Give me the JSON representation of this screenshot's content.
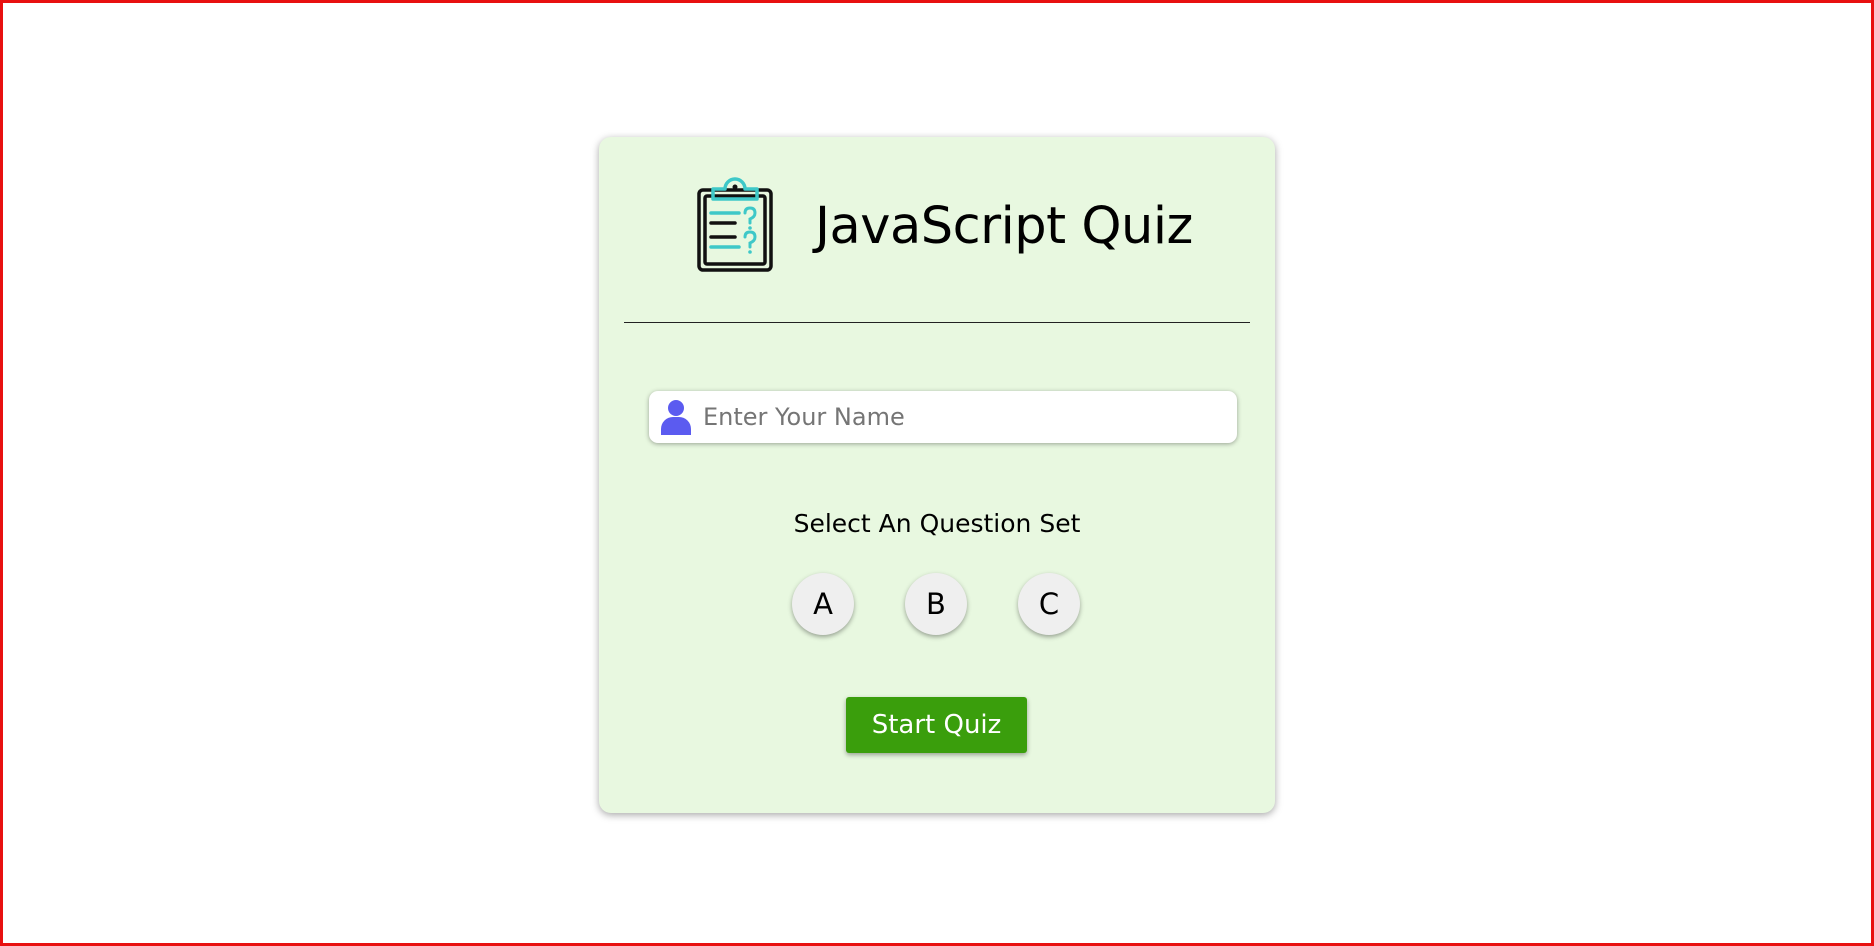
{
  "quiz": {
    "title": "JavaScript Quiz",
    "logo_icon": "clipboard-question-icon",
    "name_input": {
      "placeholder": "Enter Your Name",
      "value": "",
      "icon": "user-icon"
    },
    "set_label": "Select An Question Set",
    "sets": [
      "A",
      "B",
      "C"
    ],
    "start_label": "Start Quiz"
  },
  "colors": {
    "card_background": "#e8f8e0",
    "start_button": "#3a9e0c",
    "user_icon": "#5b5bf0",
    "logo_accent": "#3ec8c8",
    "frame_border": "#e81010"
  }
}
